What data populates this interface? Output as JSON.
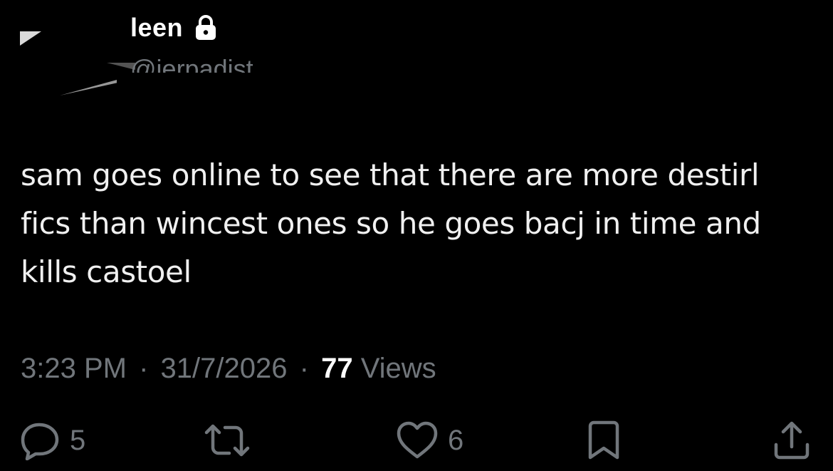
{
  "author": {
    "display_name": "leen",
    "handle": "@jerpadist",
    "locked_icon": "lock-icon"
  },
  "tweet": {
    "text": "sam goes online to see that there are more destirl fics than wincest ones so he goes bacj in time and kills castoel"
  },
  "meta": {
    "time": "3:23 PM",
    "separator": "·",
    "date": "31/7/2026",
    "views_count": "77",
    "views_label": "Views"
  },
  "actions": {
    "reply": {
      "icon": "reply-icon",
      "count": "5"
    },
    "retweet": {
      "icon": "retweet-icon",
      "count": ""
    },
    "like": {
      "icon": "heart-icon",
      "count": "6"
    },
    "bookmark": {
      "icon": "bookmark-icon"
    },
    "share": {
      "icon": "share-icon"
    }
  },
  "colors": {
    "background": "#000000",
    "primary_text": "#e7e9ea",
    "secondary_text": "#71767b"
  }
}
